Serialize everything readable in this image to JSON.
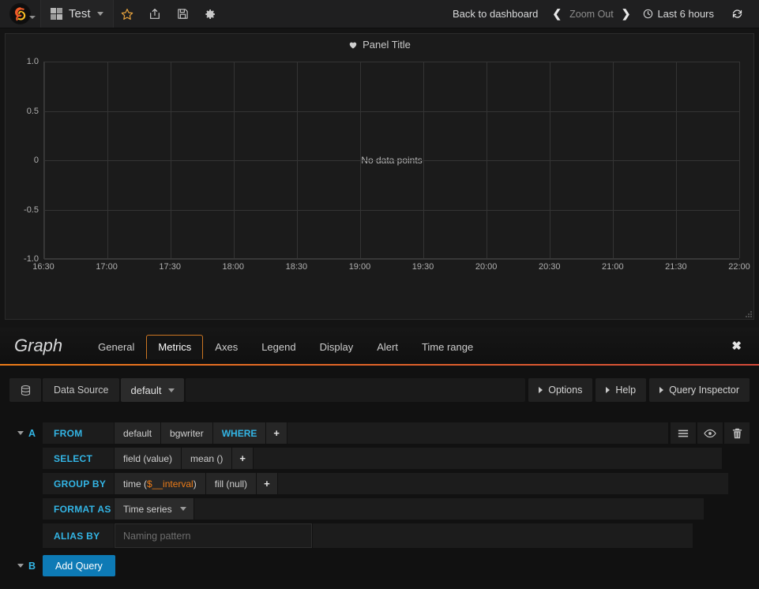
{
  "navbar": {
    "logo_icon": "grafana-logo-icon",
    "dashboard_title": "Test",
    "icons": [
      {
        "name": "star-icon",
        "glyph": "star"
      },
      {
        "name": "share-icon",
        "glyph": "share"
      },
      {
        "name": "save-icon",
        "glyph": "floppy"
      },
      {
        "name": "settings-gear-icon",
        "glyph": "gear"
      }
    ],
    "back_to_dashboard": "Back to dashboard",
    "zoom_prev_arrow": "❮",
    "zoom_out_label": "Zoom Out",
    "zoom_next_arrow": "❯",
    "time_range_label": "Last 6 hours",
    "time_range_icon": "clock-icon",
    "refresh_icon": "refresh-icon"
  },
  "panel": {
    "title": "Panel Title",
    "title_icon": "heart-icon",
    "no_data_text": "No data points"
  },
  "chart_data": {
    "type": "line",
    "title": "Panel Title",
    "series": [],
    "x": [],
    "values": [],
    "xlabel": "",
    "ylabel": "",
    "ylim": [
      -1.0,
      1.0
    ],
    "y_ticks": [
      "1.0",
      "0.5",
      "0",
      "-0.5",
      "-1.0"
    ],
    "y_tick_values": [
      1.0,
      0.5,
      0,
      -0.5,
      -1.0
    ],
    "x_ticks": [
      "16:30",
      "17:00",
      "17:30",
      "18:00",
      "18:30",
      "19:00",
      "19:30",
      "20:00",
      "20:30",
      "21:00",
      "21:30",
      "22:00"
    ],
    "grid": true,
    "legend": "none",
    "empty_message": "No data points"
  },
  "editor": {
    "type_label": "Graph",
    "tabs": [
      {
        "label": "General",
        "active": false
      },
      {
        "label": "Metrics",
        "active": true
      },
      {
        "label": "Axes",
        "active": false
      },
      {
        "label": "Legend",
        "active": false
      },
      {
        "label": "Display",
        "active": false
      },
      {
        "label": "Alert",
        "active": false
      },
      {
        "label": "Time range",
        "active": false
      }
    ],
    "close_label": "✖",
    "datasource": {
      "icon": "database-icon",
      "label": "Data Source",
      "value": "default"
    },
    "buttons": [
      {
        "label": "Options",
        "name": "options-button"
      },
      {
        "label": "Help",
        "name": "help-button"
      },
      {
        "label": "Query Inspector",
        "name": "query-inspector-button"
      }
    ],
    "query_a": {
      "ref_id": "A",
      "from_label": "FROM",
      "from_policy": "default",
      "from_measurement": "bgwriter",
      "where_label": "WHERE",
      "where_add": "+",
      "select_label": "SELECT",
      "select_field": "field (value)",
      "select_func": "mean ()",
      "select_add": "+",
      "groupby_label": "GROUP BY",
      "groupby_time_pre": "time (",
      "groupby_time_var": "$__interval",
      "groupby_time_post": ")",
      "groupby_fill": "fill (null)",
      "groupby_add": "+",
      "format_label": "FORMAT AS",
      "format_value": "Time series",
      "alias_label": "ALIAS BY",
      "alias_value": "",
      "alias_placeholder": "Naming pattern",
      "actions": [
        {
          "name": "toggle-edit-mode-icon",
          "glyph": "list"
        },
        {
          "name": "toggle-visibility-eye-icon",
          "glyph": "eye"
        },
        {
          "name": "delete-query-trash-icon",
          "glyph": "trash"
        }
      ]
    },
    "query_b": {
      "ref_id": "B",
      "add_query_label": "Add Query"
    }
  },
  "colors": {
    "accent_orange": "#eb7b18",
    "accent_blue": "#33b5e5",
    "button_blue": "#0d7ab5",
    "background": "#141414",
    "panel_background": "#1b1b1b"
  }
}
